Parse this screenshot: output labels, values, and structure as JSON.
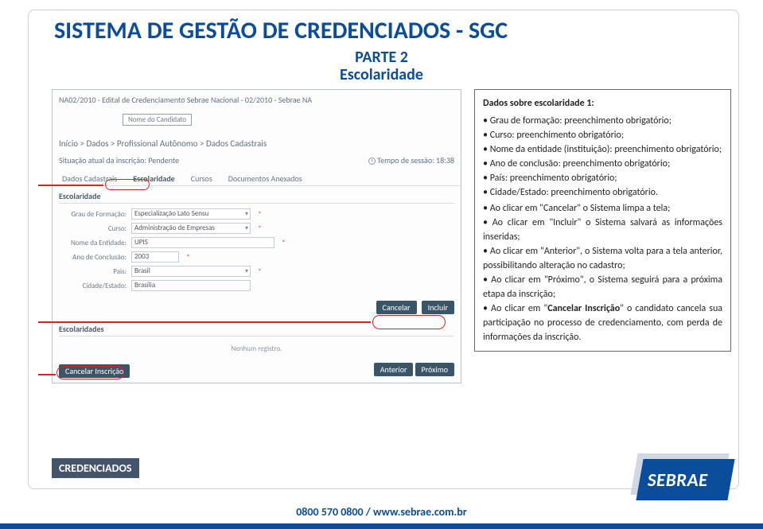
{
  "header": {
    "title": "SISTEMA DE GESTÃO DE CREDENCIADOS - SGC",
    "subtitle1": "PARTE 2",
    "subtitle2": "Escolaridade"
  },
  "screenshot": {
    "edital": "NA02/2010 - Edital de Credenciamento Sebrae Nacional - 02/2010 - Sebrae NA",
    "nome_candidato_label": "Nome do Candidato",
    "breadcrumb": "Início > Dados > Profissional Autônomo > Dados Cadastrais",
    "status_label": "Situação atual da inscrição: Pendente",
    "tempo_sessao": "Tempo de sessão: 18:38",
    "tabs": [
      "Dados Cadastrais",
      "Escolaridade",
      "Cursos",
      "Documentos Anexados"
    ],
    "section1": "Escolaridade",
    "form": {
      "grau_label": "Grau de Formação:",
      "grau_value": "Especialização Lato Sensu",
      "curso_label": "Curso:",
      "curso_value": "Administração de Empresas",
      "entidade_label": "Nome da Entidade:",
      "entidade_value": "UPIS",
      "ano_label": "Ano de Conclusão:",
      "ano_value": "2003",
      "pais_label": "Pais:",
      "pais_value": "Brasil",
      "cidade_label": "Cidade/Estado:",
      "cidade_value": "Brasília"
    },
    "btn_cancelar": "Cancelar",
    "btn_incluir": "Incluir",
    "section2": "Escolaridades",
    "empty_msg": "Nenhum registro.",
    "btn_cancel_inscricao": "Cancelar Inscrição",
    "btn_anterior": "Anterior",
    "btn_proximo": "Próximo"
  },
  "info": {
    "heading": "Dados sobre escolaridade 1:",
    "bullets1": [
      "Grau de formação: preenchimento obrigatório;",
      "Curso: preenchimento obrigatório;",
      "Nome da entidade (instituição): preenchimento obrigatório;",
      "Ano de conclusão: preenchimento obrigatório;",
      "País: preenchimento obrigatório;",
      "Cidade/Estado: preenchimento obrigatório."
    ],
    "b2_l1a": "Ao  clicar em  \"Cancelar\" o Sistema limpa a tela;",
    "b2_l2": "Ao  clicar  em  \"Incluir\"  o  Sistema  salvará  as  informações inseridas;",
    "b2_l3": "Ao clicar em \"Anterior\", o Sistema volta para a tela anterior, possibilitando alteração no cadastro;",
    "b2_l4": "Ao  clicar  em  \"Próximo\",  o  Sistema  seguirá  para  a  próxima etapa da inscrição;",
    "b2_l5a": "Ao clicar em \"",
    "b2_l5b": "Cancelar Inscrição",
    "b2_l5c": "\" o candidato cancela sua participação no processo de credenciamento, com perda de informações da inscrição."
  },
  "footer": {
    "badge": "CREDENCIADOS",
    "phone": "0800 570 0800",
    "url": "www.sebrae.com.br",
    "slash": " / ",
    "logo": "SEBRAE"
  }
}
